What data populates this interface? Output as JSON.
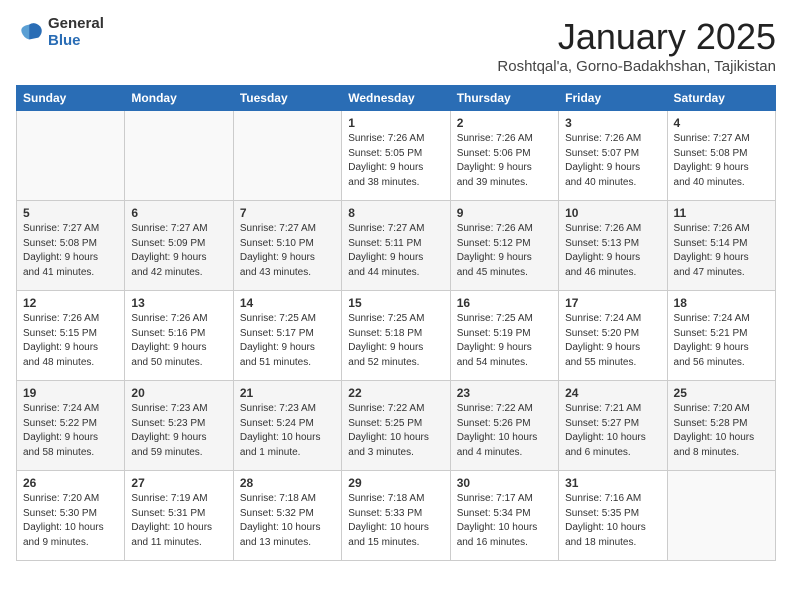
{
  "logo": {
    "general": "General",
    "blue": "Blue"
  },
  "header": {
    "title": "January 2025",
    "subtitle": "Roshtqal'a, Gorno-Badakhshan, Tajikistan"
  },
  "days_of_week": [
    "Sunday",
    "Monday",
    "Tuesday",
    "Wednesday",
    "Thursday",
    "Friday",
    "Saturday"
  ],
  "weeks": [
    [
      {
        "num": "",
        "info": ""
      },
      {
        "num": "",
        "info": ""
      },
      {
        "num": "",
        "info": ""
      },
      {
        "num": "1",
        "info": "Sunrise: 7:26 AM\nSunset: 5:05 PM\nDaylight: 9 hours\nand 38 minutes."
      },
      {
        "num": "2",
        "info": "Sunrise: 7:26 AM\nSunset: 5:06 PM\nDaylight: 9 hours\nand 39 minutes."
      },
      {
        "num": "3",
        "info": "Sunrise: 7:26 AM\nSunset: 5:07 PM\nDaylight: 9 hours\nand 40 minutes."
      },
      {
        "num": "4",
        "info": "Sunrise: 7:27 AM\nSunset: 5:08 PM\nDaylight: 9 hours\nand 40 minutes."
      }
    ],
    [
      {
        "num": "5",
        "info": "Sunrise: 7:27 AM\nSunset: 5:08 PM\nDaylight: 9 hours\nand 41 minutes."
      },
      {
        "num": "6",
        "info": "Sunrise: 7:27 AM\nSunset: 5:09 PM\nDaylight: 9 hours\nand 42 minutes."
      },
      {
        "num": "7",
        "info": "Sunrise: 7:27 AM\nSunset: 5:10 PM\nDaylight: 9 hours\nand 43 minutes."
      },
      {
        "num": "8",
        "info": "Sunrise: 7:27 AM\nSunset: 5:11 PM\nDaylight: 9 hours\nand 44 minutes."
      },
      {
        "num": "9",
        "info": "Sunrise: 7:26 AM\nSunset: 5:12 PM\nDaylight: 9 hours\nand 45 minutes."
      },
      {
        "num": "10",
        "info": "Sunrise: 7:26 AM\nSunset: 5:13 PM\nDaylight: 9 hours\nand 46 minutes."
      },
      {
        "num": "11",
        "info": "Sunrise: 7:26 AM\nSunset: 5:14 PM\nDaylight: 9 hours\nand 47 minutes."
      }
    ],
    [
      {
        "num": "12",
        "info": "Sunrise: 7:26 AM\nSunset: 5:15 PM\nDaylight: 9 hours\nand 48 minutes."
      },
      {
        "num": "13",
        "info": "Sunrise: 7:26 AM\nSunset: 5:16 PM\nDaylight: 9 hours\nand 50 minutes."
      },
      {
        "num": "14",
        "info": "Sunrise: 7:25 AM\nSunset: 5:17 PM\nDaylight: 9 hours\nand 51 minutes."
      },
      {
        "num": "15",
        "info": "Sunrise: 7:25 AM\nSunset: 5:18 PM\nDaylight: 9 hours\nand 52 minutes."
      },
      {
        "num": "16",
        "info": "Sunrise: 7:25 AM\nSunset: 5:19 PM\nDaylight: 9 hours\nand 54 minutes."
      },
      {
        "num": "17",
        "info": "Sunrise: 7:24 AM\nSunset: 5:20 PM\nDaylight: 9 hours\nand 55 minutes."
      },
      {
        "num": "18",
        "info": "Sunrise: 7:24 AM\nSunset: 5:21 PM\nDaylight: 9 hours\nand 56 minutes."
      }
    ],
    [
      {
        "num": "19",
        "info": "Sunrise: 7:24 AM\nSunset: 5:22 PM\nDaylight: 9 hours\nand 58 minutes."
      },
      {
        "num": "20",
        "info": "Sunrise: 7:23 AM\nSunset: 5:23 PM\nDaylight: 9 hours\nand 59 minutes."
      },
      {
        "num": "21",
        "info": "Sunrise: 7:23 AM\nSunset: 5:24 PM\nDaylight: 10 hours\nand 1 minute."
      },
      {
        "num": "22",
        "info": "Sunrise: 7:22 AM\nSunset: 5:25 PM\nDaylight: 10 hours\nand 3 minutes."
      },
      {
        "num": "23",
        "info": "Sunrise: 7:22 AM\nSunset: 5:26 PM\nDaylight: 10 hours\nand 4 minutes."
      },
      {
        "num": "24",
        "info": "Sunrise: 7:21 AM\nSunset: 5:27 PM\nDaylight: 10 hours\nand 6 minutes."
      },
      {
        "num": "25",
        "info": "Sunrise: 7:20 AM\nSunset: 5:28 PM\nDaylight: 10 hours\nand 8 minutes."
      }
    ],
    [
      {
        "num": "26",
        "info": "Sunrise: 7:20 AM\nSunset: 5:30 PM\nDaylight: 10 hours\nand 9 minutes."
      },
      {
        "num": "27",
        "info": "Sunrise: 7:19 AM\nSunset: 5:31 PM\nDaylight: 10 hours\nand 11 minutes."
      },
      {
        "num": "28",
        "info": "Sunrise: 7:18 AM\nSunset: 5:32 PM\nDaylight: 10 hours\nand 13 minutes."
      },
      {
        "num": "29",
        "info": "Sunrise: 7:18 AM\nSunset: 5:33 PM\nDaylight: 10 hours\nand 15 minutes."
      },
      {
        "num": "30",
        "info": "Sunrise: 7:17 AM\nSunset: 5:34 PM\nDaylight: 10 hours\nand 16 minutes."
      },
      {
        "num": "31",
        "info": "Sunrise: 7:16 AM\nSunset: 5:35 PM\nDaylight: 10 hours\nand 18 minutes."
      },
      {
        "num": "",
        "info": ""
      }
    ]
  ]
}
